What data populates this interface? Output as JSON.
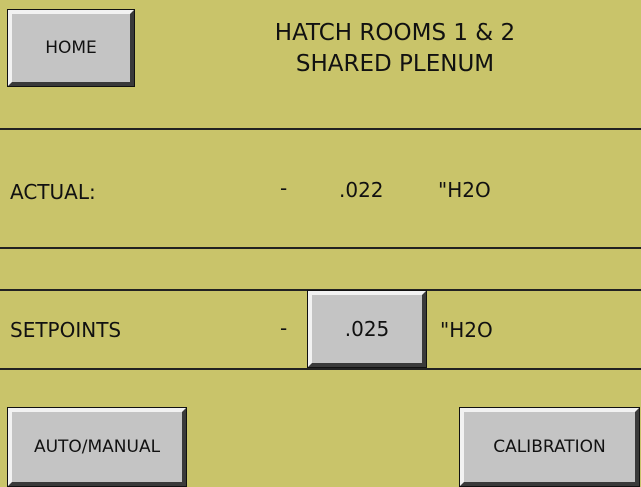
{
  "header": {
    "home_label": "HOME",
    "title_line1": "HATCH ROOMS 1 & 2",
    "title_line2": "SHARED PLENUM"
  },
  "actual": {
    "label": "ACTUAL:",
    "sign": "-",
    "value": ".022",
    "unit": "\"H2O"
  },
  "setpoints": {
    "label": "SETPOINTS",
    "sign": "-",
    "value": ".025",
    "unit": "\"H2O"
  },
  "footer": {
    "auto_manual_label": "AUTO/MANUAL",
    "calibration_label": "CALIBRATION"
  }
}
